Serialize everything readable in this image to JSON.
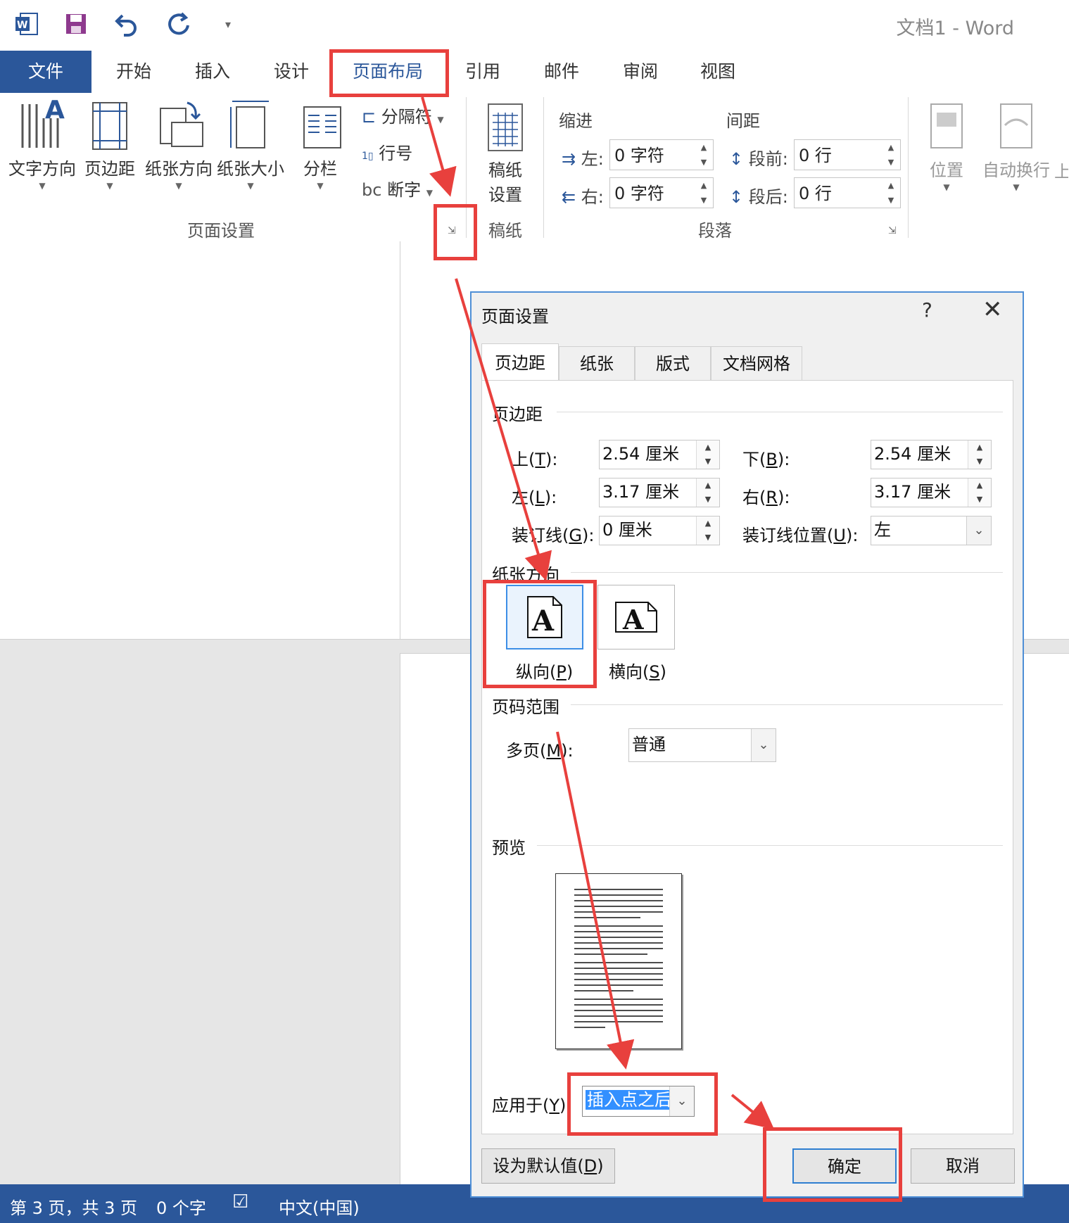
{
  "window": {
    "title": "文档1 - Word"
  },
  "quick_access": {
    "more": "▾"
  },
  "tabs": [
    {
      "label": "文件"
    },
    {
      "label": "开始"
    },
    {
      "label": "插入"
    },
    {
      "label": "设计"
    },
    {
      "label": "页面布局"
    },
    {
      "label": "引用"
    },
    {
      "label": "邮件"
    },
    {
      "label": "审阅"
    },
    {
      "label": "视图"
    }
  ],
  "ribbon": {
    "page_setup": {
      "label": "页面设置",
      "text_direction": "文字方向",
      "margins": "页边距",
      "orientation": "纸张方向",
      "size": "纸张大小",
      "columns": "分栏",
      "breaks": "分隔符",
      "line_numbers": "行号",
      "hyphenation": "断字"
    },
    "manuscript": {
      "label": "稿纸",
      "button_line1": "稿纸",
      "button_line2": "设置"
    },
    "paragraph": {
      "label": "段落",
      "indent_title": "缩进",
      "spacing_title": "间距",
      "left_label": "左:",
      "left_value": "0 字符",
      "right_label": "右:",
      "right_value": "0 字符",
      "before_label": "段前:",
      "before_value": "0 行",
      "after_label": "段后:",
      "after_value": "0 行"
    },
    "arrange": {
      "position": "位置",
      "wrap": "自动换行",
      "forward": "上"
    }
  },
  "status": {
    "page": "第 3 页，共 3 页",
    "words": "0 个字",
    "language": "中文(中国)"
  },
  "dialog": {
    "title": "页面设置",
    "help": "?",
    "close": "✕",
    "tabs": [
      "页边距",
      "纸张",
      "版式",
      "文档网格"
    ],
    "margins_section": "页边距",
    "top_label": "上(T):",
    "top_value": "2.54 厘米",
    "bottom_label": "下(B):",
    "bottom_value": "2.54 厘米",
    "left_label": "左(L):",
    "left_value": "3.17 厘米",
    "right_label": "右(R):",
    "right_value": "3.17 厘米",
    "gutter_label": "装订线(G):",
    "gutter_value": "0 厘米",
    "gutter_pos_label": "装订线位置(U):",
    "gutter_pos_value": "左",
    "orientation_section": "纸张方向",
    "portrait": "纵向(P)",
    "landscape": "横向(S)",
    "pages_section": "页码范围",
    "multiple_label": "多页(M):",
    "multiple_value": "普通",
    "preview_section": "预览",
    "apply_label": "应用于(Y):",
    "apply_value": "插入点之后",
    "default_button": "设为默认值(D)",
    "ok_button": "确定",
    "cancel_button": "取消"
  },
  "colors": {
    "accent": "#2b579a",
    "annotation": "#e8403d",
    "focus": "#3c8ee6"
  }
}
